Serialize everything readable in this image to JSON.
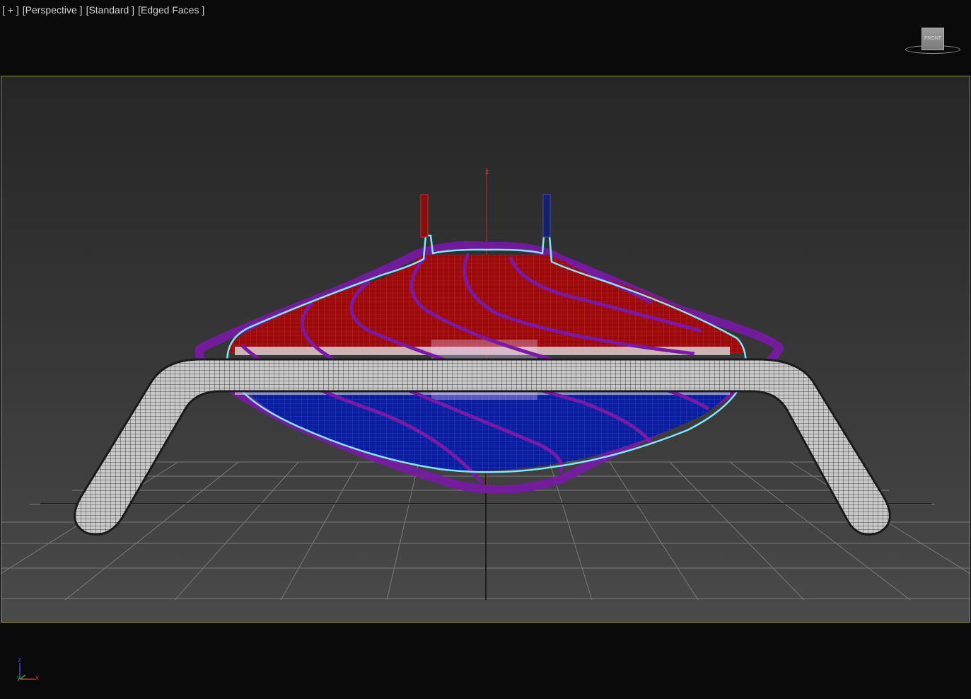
{
  "viewport": {
    "labels": {
      "plus": "[ + ]",
      "view": "[Perspective ]",
      "shading": "[Standard ]",
      "edges": "[Edged Faces ]"
    },
    "viewcube": {
      "face_label": "FRONT"
    },
    "gizmo": {
      "z_label": "z"
    },
    "axis_tripod": {
      "z": "z",
      "y": "y",
      "x": "x"
    }
  },
  "colors": {
    "background": "#0a0a0a",
    "viewport_border": "#9a9636",
    "red_half": "#9b0b0b",
    "blue_half": "#0b1ea0",
    "purple_curves": "#7a18a8",
    "cyan_outline": "#7fe6ff",
    "pipe": "#b8b8b8",
    "grid": "#7a7a7a"
  }
}
